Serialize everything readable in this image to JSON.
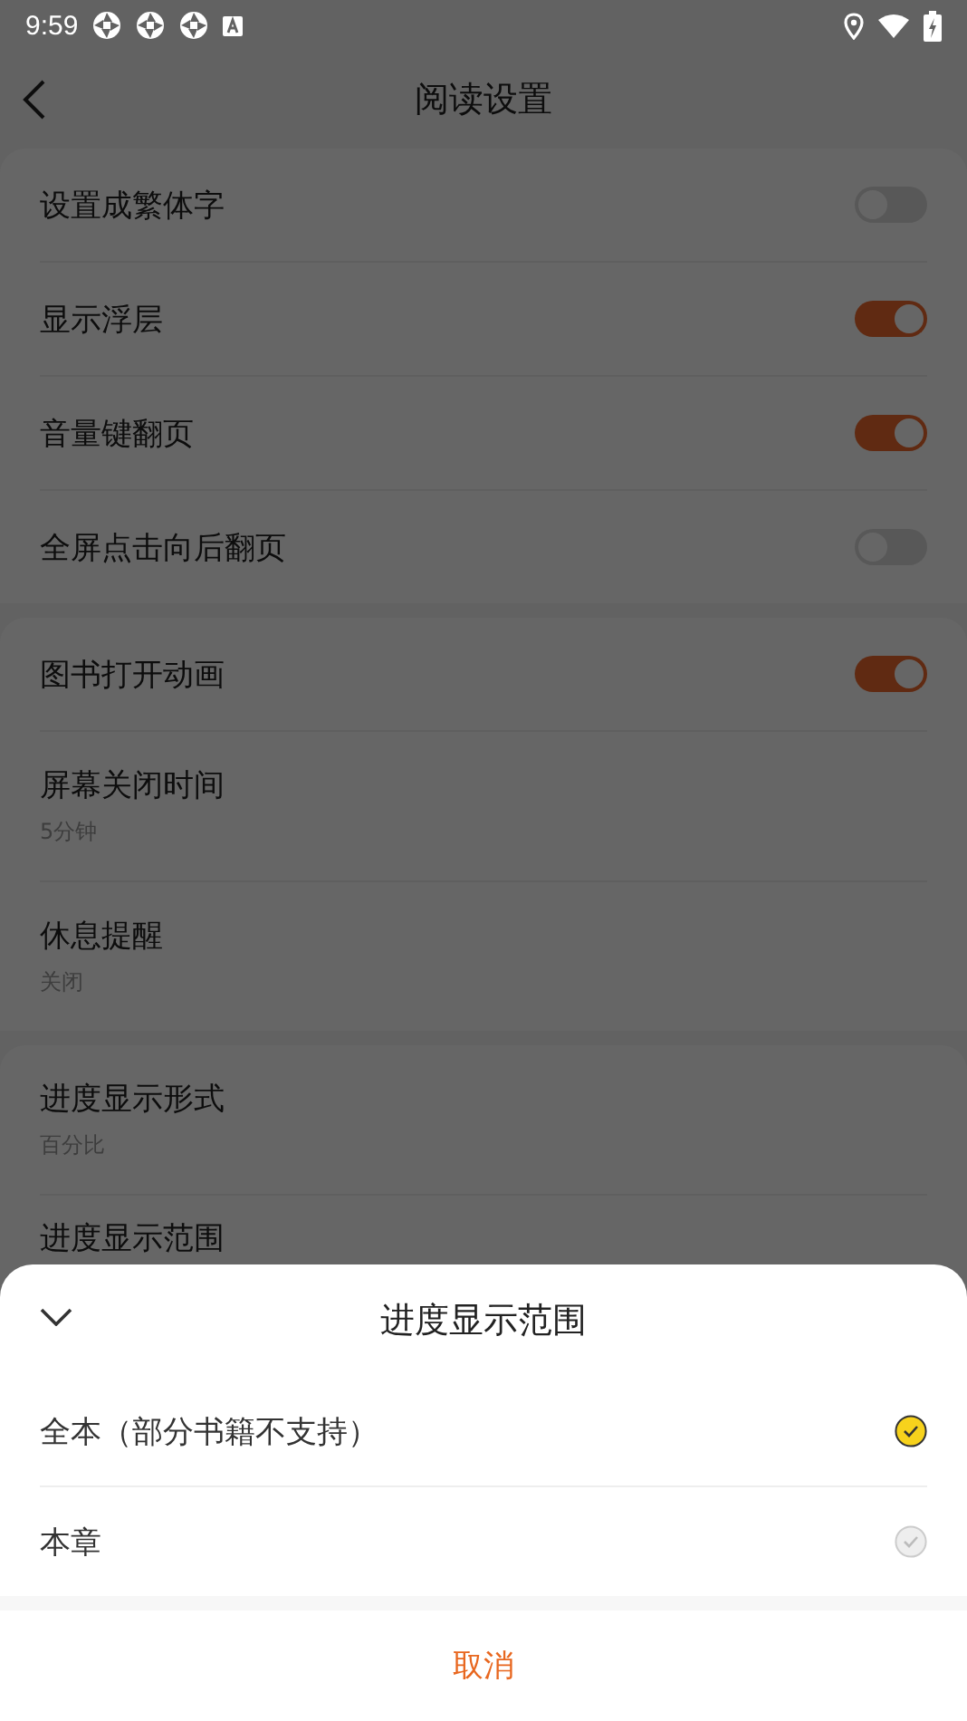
{
  "status_bar": {
    "time": "9:59"
  },
  "header": {
    "title": "阅读设置"
  },
  "groups": [
    {
      "rows": [
        {
          "kind": "toggle",
          "label": "设置成繁体字",
          "on": false
        },
        {
          "kind": "toggle",
          "label": "显示浮层",
          "on": true
        },
        {
          "kind": "toggle",
          "label": "音量键翻页",
          "on": true
        },
        {
          "kind": "toggle",
          "label": "全屏点击向后翻页",
          "on": false
        }
      ]
    },
    {
      "rows": [
        {
          "kind": "toggle",
          "label": "图书打开动画",
          "on": true
        },
        {
          "kind": "value",
          "label": "屏幕关闭时间",
          "value": "5分钟"
        },
        {
          "kind": "value",
          "label": "休息提醒",
          "value": "关闭"
        }
      ]
    },
    {
      "rows": [
        {
          "kind": "value",
          "label": "进度显示形式",
          "value": "百分比"
        },
        {
          "kind": "value",
          "label": "进度显示范围"
        }
      ]
    }
  ],
  "sheet": {
    "title": "进度显示范围",
    "options": [
      {
        "label": "全本（部分书籍不支持）",
        "selected": true
      },
      {
        "label": "本章",
        "selected": false
      }
    ],
    "cancel": "取消"
  }
}
